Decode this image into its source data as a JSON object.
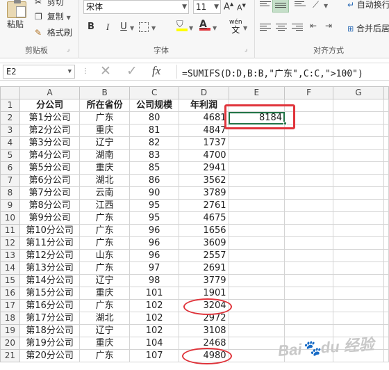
{
  "ribbon": {
    "clipboard": {
      "cut_label": "剪切",
      "paste_label": "粘贴",
      "copy_label": "复制",
      "format_painter_label": "格式刷",
      "group_label": "剪贴板"
    },
    "font": {
      "font_name": "宋体",
      "font_size": "11",
      "bold": "B",
      "italic": "I",
      "underline": "U",
      "font_color_letter": "A",
      "wen_label": "wén",
      "wen_char": "文",
      "group_label": "字体"
    },
    "alignment": {
      "wrap_text_label": "自动换行",
      "merge_center_label": "合并后居中",
      "group_label": "对齐方式"
    }
  },
  "formula_bar": {
    "name_box": "E2",
    "fx": "fx",
    "formula": "=SUMIFS(D:D,B:B,\"广东\",C:C,\">100\")"
  },
  "grid": {
    "columns": [
      "A",
      "B",
      "C",
      "D",
      "E",
      "F",
      "G"
    ],
    "header_row": [
      "分公司",
      "所在省份",
      "公司规模",
      "年利润"
    ],
    "rows": [
      [
        "第1分公司",
        "广东",
        "80",
        "4681"
      ],
      [
        "第2分公司",
        "重庆",
        "81",
        "4847"
      ],
      [
        "第3分公司",
        "辽宁",
        "82",
        "1737"
      ],
      [
        "第4分公司",
        "湖南",
        "83",
        "4700"
      ],
      [
        "第5分公司",
        "重庆",
        "85",
        "2941"
      ],
      [
        "第6分公司",
        "湖北",
        "86",
        "3562"
      ],
      [
        "第7分公司",
        "云南",
        "90",
        "3789"
      ],
      [
        "第8分公司",
        "江西",
        "95",
        "2761"
      ],
      [
        "第9分公司",
        "广东",
        "95",
        "4675"
      ],
      [
        "第10分公司",
        "广东",
        "96",
        "1656"
      ],
      [
        "第11分公司",
        "广东",
        "96",
        "3609"
      ],
      [
        "第12分公司",
        "山东",
        "96",
        "2557"
      ],
      [
        "第13分公司",
        "广东",
        "97",
        "2691"
      ],
      [
        "第14分公司",
        "辽宁",
        "98",
        "3779"
      ],
      [
        "第15分公司",
        "重庆",
        "101",
        "1901"
      ],
      [
        "第16分公司",
        "广东",
        "102",
        "3204"
      ],
      [
        "第17分公司",
        "湖北",
        "102",
        "2972"
      ],
      [
        "第18分公司",
        "辽宁",
        "102",
        "3108"
      ],
      [
        "第19分公司",
        "重庆",
        "104",
        "2468"
      ],
      [
        "第20分公司",
        "广东",
        "107",
        "4980"
      ]
    ],
    "e2_value": "8184",
    "row_numbers": [
      "1",
      "2",
      "3",
      "4",
      "5",
      "6",
      "7",
      "8",
      "9",
      "10",
      "11",
      "12",
      "13",
      "14",
      "15",
      "16",
      "17",
      "18",
      "19",
      "20",
      "21"
    ]
  },
  "watermark": "Baidu 经验",
  "colors": {
    "accent_green": "#217346",
    "annotation_red": "#e0343b"
  }
}
